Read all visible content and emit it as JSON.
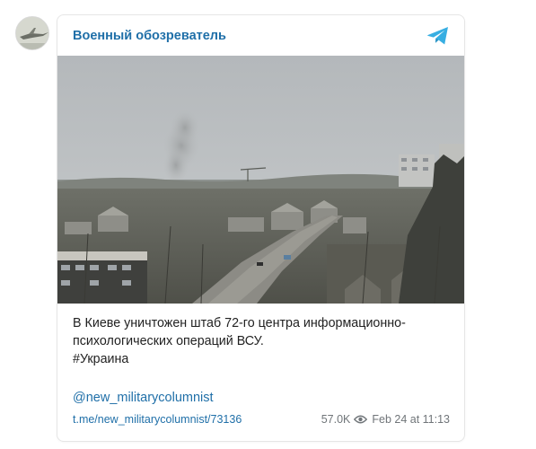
{
  "channel": {
    "name": "Военный обозреватель",
    "avatar_icon": "channel-avatar"
  },
  "post": {
    "caption_lines": [
      "В Киеве уничтожен штаб 72-го центра информационно-",
      "психологических операций ВСУ."
    ],
    "hashtag": "#Украина",
    "handle": "@new_militarycolumnist",
    "link": "t.me/new_militarycolumnist/73136",
    "views": "57.0K",
    "date": "Feb 24 at 11:13"
  },
  "icons": {
    "telegram": "telegram-logo-icon",
    "views": "eye-icon"
  },
  "colors": {
    "accent": "#1f6fa8",
    "telegram": "#37aee2",
    "text": "#222222",
    "meta": "#707579"
  }
}
